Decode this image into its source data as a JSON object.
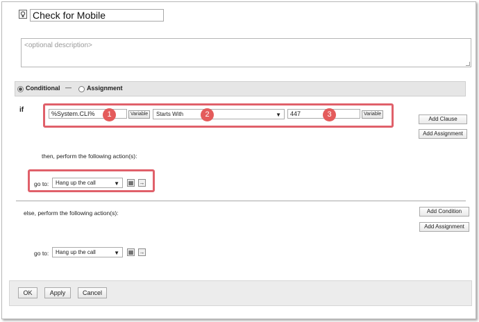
{
  "header": {
    "title_value": "Check for Mobile",
    "icon": "bulb-icon"
  },
  "description": {
    "placeholder": "<optional description>"
  },
  "mode": {
    "conditional_label": "Conditional",
    "separator": "—",
    "assignment_label": "Assignment",
    "selected": "Conditional"
  },
  "condition": {
    "if_label": "if",
    "left_value": "%System.CLI%",
    "left_variable_button": "Variable",
    "operator": "Starts With",
    "right_value": "447",
    "right_variable_button": "Variable",
    "add_clause_button": "Add Clause",
    "add_assignment_button": "Add Assignment"
  },
  "badges": [
    "1",
    "2",
    "3"
  ],
  "then": {
    "label": "then, perform the following action(s):",
    "goto_label": "go to:",
    "goto_value": "Hang up the call"
  },
  "else": {
    "label": "else, perform the following action(s):",
    "add_condition_button": "Add Condition",
    "add_assignment_button": "Add Assignment",
    "goto_label": "go to:",
    "goto_value": "Hang up the call"
  },
  "footer": {
    "ok": "OK",
    "apply": "Apply",
    "cancel": "Cancel"
  },
  "colors": {
    "highlight": "#e0606a",
    "badge": "#e45b5b"
  }
}
